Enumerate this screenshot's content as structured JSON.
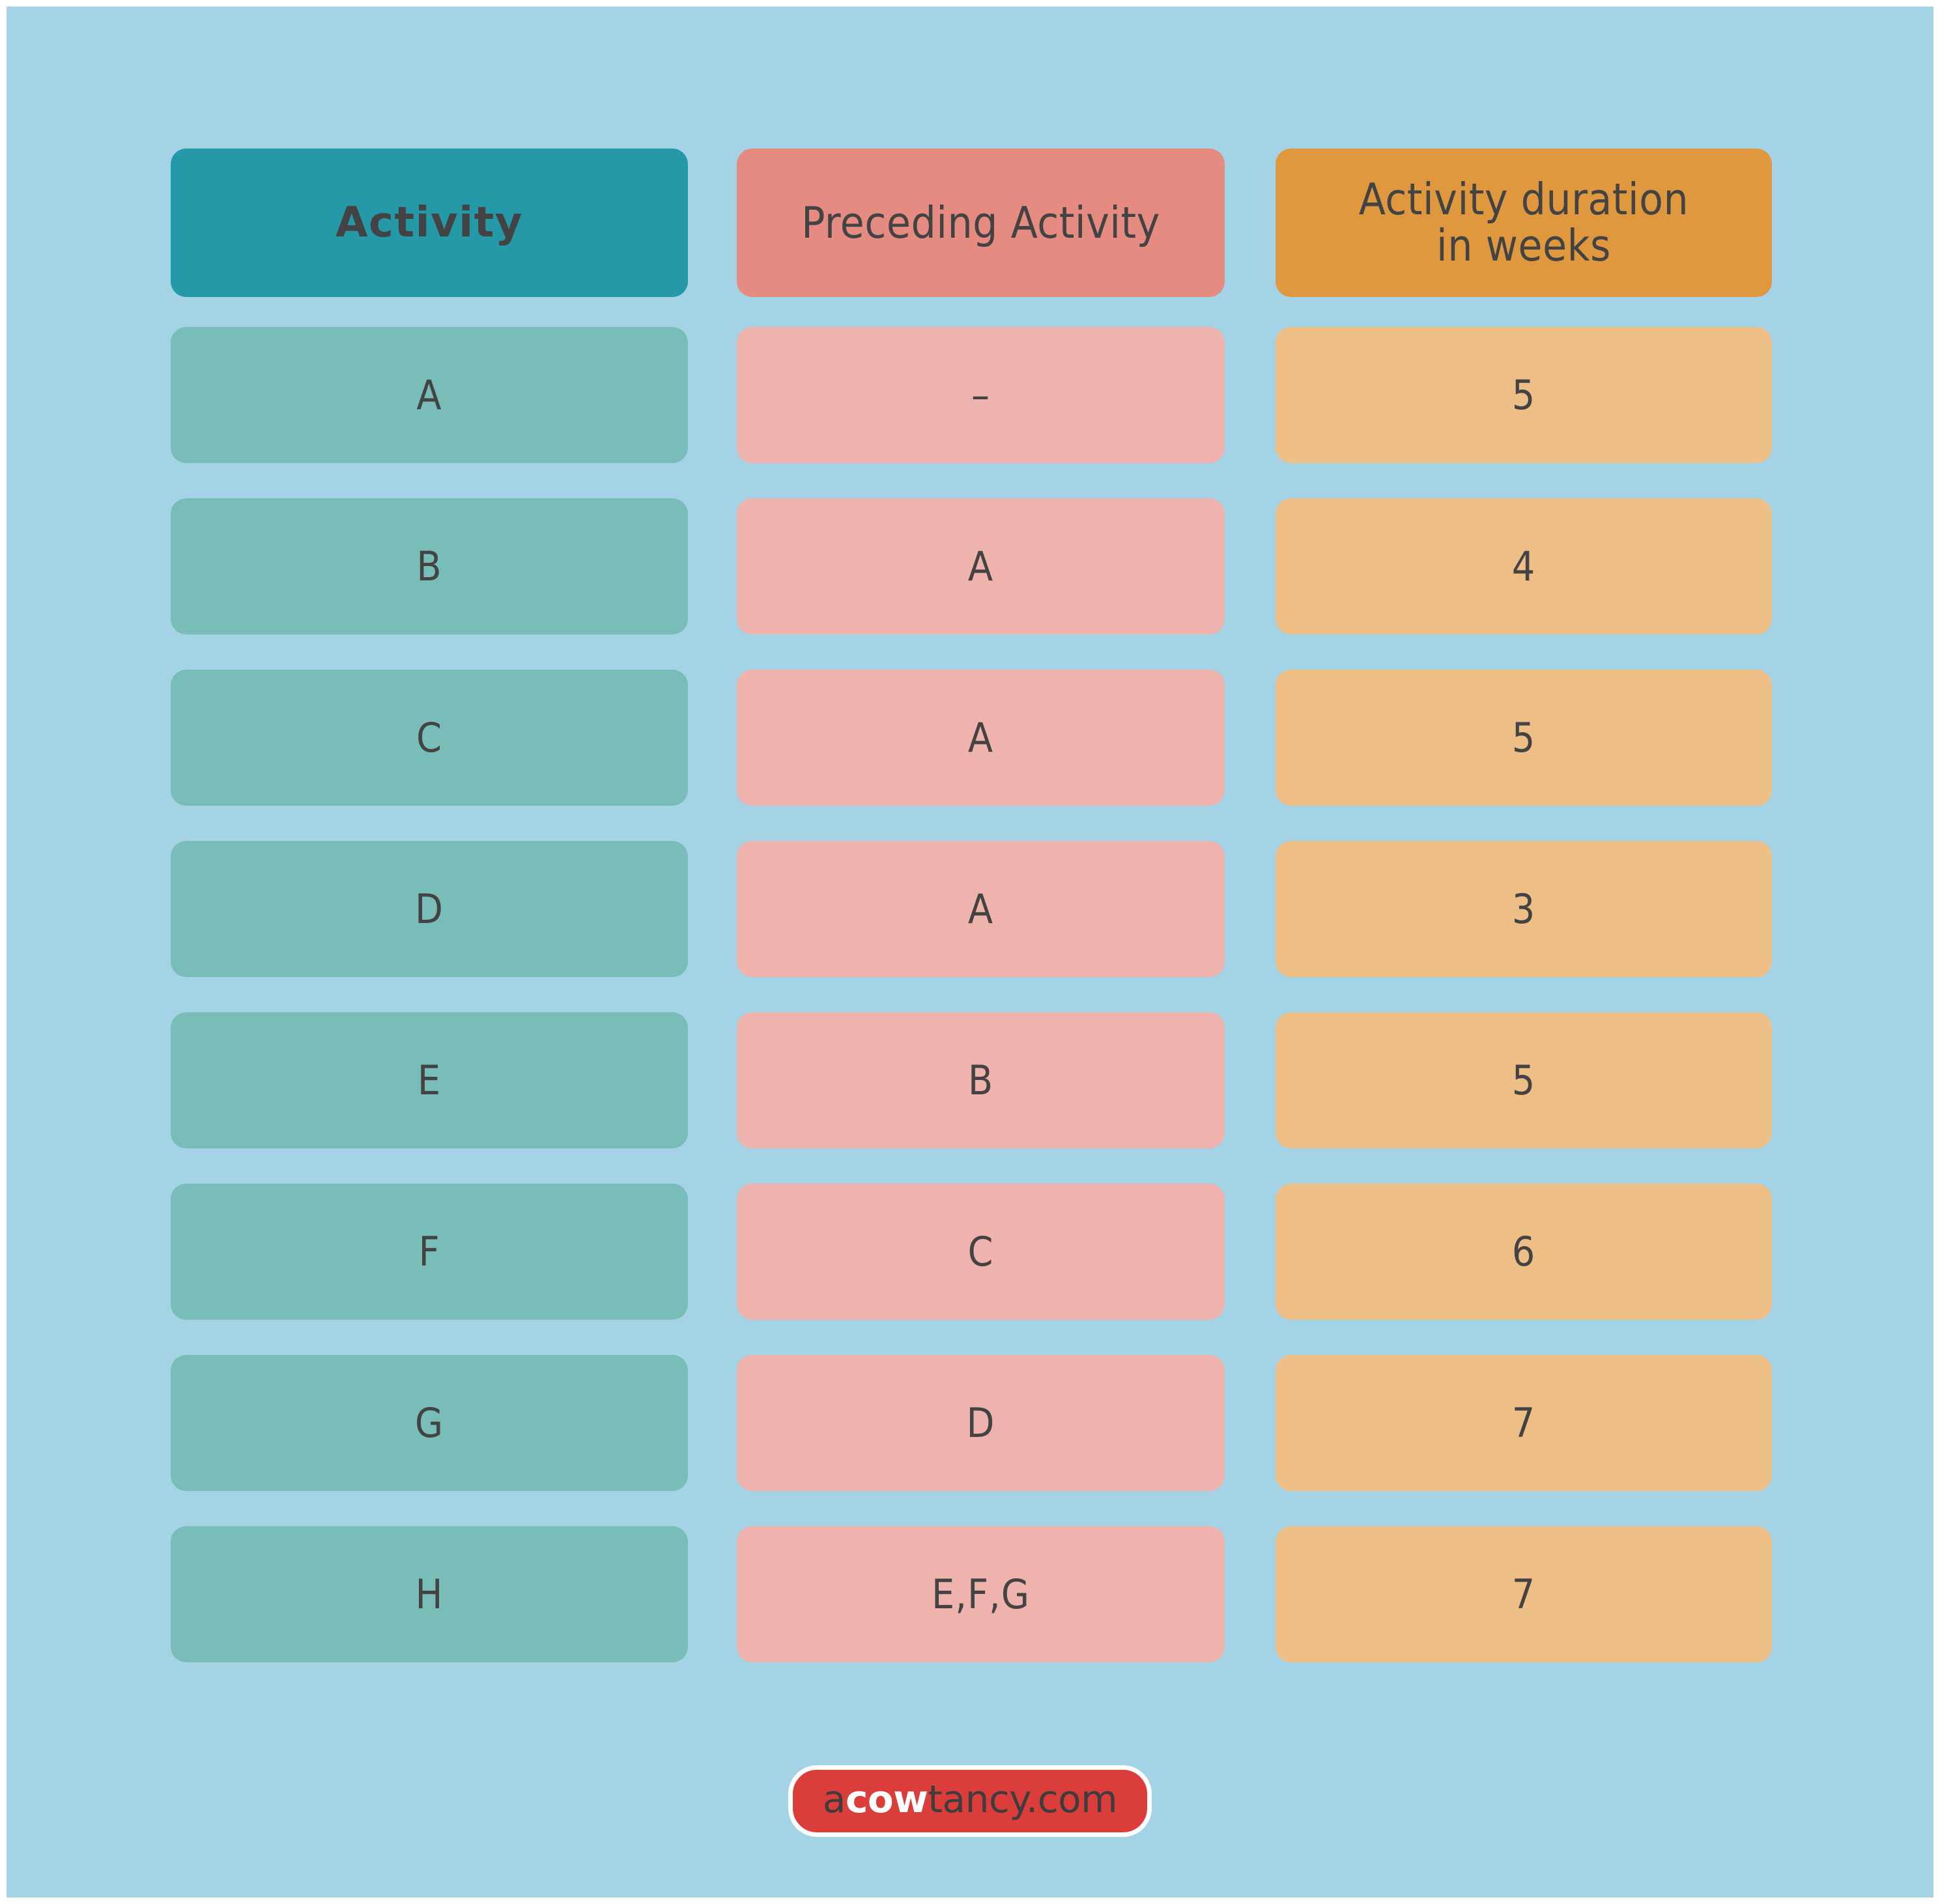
{
  "colors": {
    "page_background": "#a3d3e4",
    "header_activity": "#2599a8",
    "header_preceding": "#e58b81",
    "header_duration": "#e0983e",
    "cell_activity": "#78bdb8",
    "cell_preceding": "#efb3ae",
    "cell_duration": "#eebe87",
    "text": "#434343",
    "logo_background": "#db3d3a",
    "logo_border": "#ffffff"
  },
  "table": {
    "headers": {
      "activity": "Activity",
      "preceding": "Preceding Activity",
      "duration_line1": "Activity duration",
      "duration_line2": "in weeks"
    },
    "rows": [
      {
        "activity": "A",
        "preceding": "–",
        "duration": "5"
      },
      {
        "activity": "B",
        "preceding": "A",
        "duration": "4"
      },
      {
        "activity": "C",
        "preceding": "A",
        "duration": "5"
      },
      {
        "activity": "D",
        "preceding": "A",
        "duration": "3"
      },
      {
        "activity": "E",
        "preceding": "B",
        "duration": "5"
      },
      {
        "activity": "F",
        "preceding": "C",
        "duration": "6"
      },
      {
        "activity": "G",
        "preceding": "D",
        "duration": "7"
      },
      {
        "activity": "H",
        "preceding": "E,F,G",
        "duration": "7"
      }
    ]
  },
  "logo": {
    "prefix": "a",
    "highlight": "cow",
    "suffix": "tancy.com",
    "full": "acowtancy.com"
  }
}
